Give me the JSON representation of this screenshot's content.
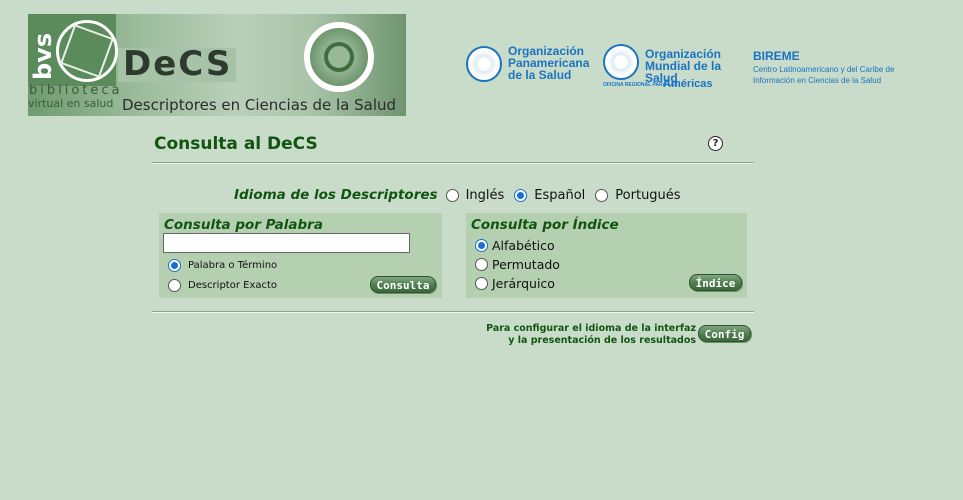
{
  "banner": {
    "bvs": "bvs",
    "biblioteca": "biblioteca",
    "virtual_en_salud": "virtual en salud",
    "decs": "DeCS",
    "descriptores": "Descriptores en Ciencias de la Salud"
  },
  "logos": {
    "ops": [
      "Organización",
      "Panamericana",
      "de la Salud"
    ],
    "oms": [
      "Organización",
      "Mundial de la Salud"
    ],
    "oms_regional": "OFICINA REGIONAL PARA LAS",
    "oms_americas": "Américas",
    "bireme_title": "BIREME",
    "bireme_lines": [
      "Centro Latinoamericano y del Caribe de",
      "Información en Ciencias de la Salud"
    ]
  },
  "page": {
    "title": "Consulta al DeCS",
    "help_symbol": "?"
  },
  "language": {
    "label": "Idioma de los Descriptores",
    "options": [
      "Inglés",
      "Español",
      "Portugués"
    ],
    "selected": "Español"
  },
  "word_search": {
    "title": "Consulta por Palabra",
    "input_value": "",
    "options": [
      "Palabra o Término",
      "Descriptor Exacto"
    ],
    "selected": "Palabra o Término",
    "button": "Consulta"
  },
  "index_search": {
    "title": "Consulta por Índice",
    "options": [
      "Alfabético",
      "Permutado",
      "Jerárquico"
    ],
    "selected": "Alfabético",
    "button": "Índice"
  },
  "config": {
    "line1": "Para configurar el idioma de la interfaz",
    "line2": "y la presentación de los resultados",
    "button": "Config"
  },
  "colors": {
    "background": "#c9dcc9",
    "panel": "#b4d0b0",
    "title_green": "#115511",
    "partner_blue": "#1a74c2"
  }
}
